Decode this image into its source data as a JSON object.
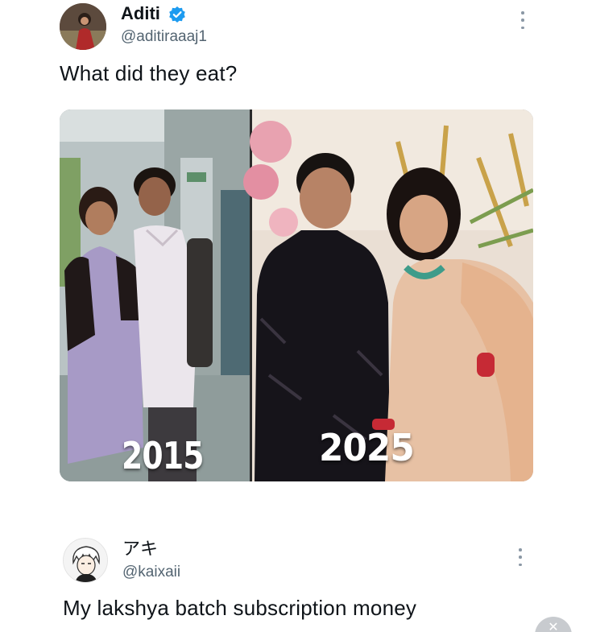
{
  "post": {
    "author": {
      "name": "Aditi",
      "handle": "@aditiraaaj1",
      "verified_color": "#1d9bf0"
    },
    "text": "What did they eat?",
    "media": {
      "left_year": "2015",
      "right_year": "2025"
    }
  },
  "reply": {
    "author": {
      "name": "アキ",
      "handle": "@kaixaii"
    },
    "text": "My lakshya batch subscription money"
  },
  "icons": {
    "post_menu": "more-vertical-icon",
    "reply_menu": "more-vertical-icon",
    "verified": "verified-badge-icon",
    "floating_button": "close-icon"
  },
  "colors": {
    "text_primary": "#0f1419",
    "text_secondary": "#536471"
  }
}
